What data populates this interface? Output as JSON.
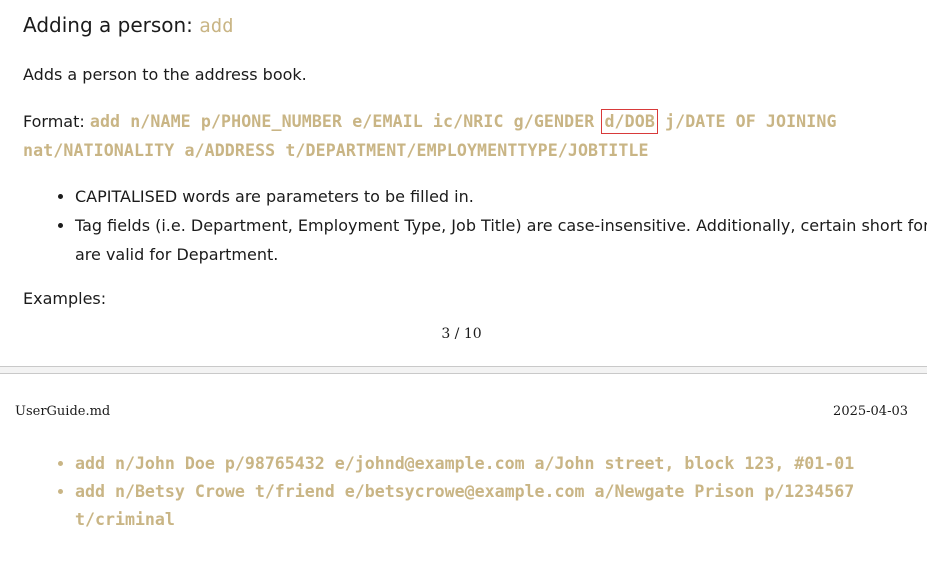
{
  "section": {
    "heading_prefix": "Adding a person: ",
    "heading_command": "add",
    "description": "Adds a person to the address book.",
    "format_label": "Format: ",
    "format_before": "add n/NAME p/PHONE_NUMBER e/EMAIL ic/NRIC g/GENDER ",
    "format_highlighted": "d/DOB",
    "format_after": " j/DATE OF JOINING nat/NATIONALITY a/ADDRESS t/DEPARTMENT/EMPLOYMENTTYPE/JOBTITLE",
    "notes": [
      "CAPITALISED words are parameters to be filled in.",
      "Tag fields (i.e. Department, Employment Type, Job Title) are case-insensitive. Additionally, certain short forms are valid for Department."
    ],
    "examples_label": "Examples:",
    "examples": [
      "add n/John Doe p/98765432 e/johnd@example.com a/John street, block 123, #01-01",
      "add n/Betsy Crowe t/friend e/betsycrowe@example.com a/Newgate Prison p/1234567 t/criminal"
    ]
  },
  "page": {
    "number": "3 / 10",
    "filename": "UserGuide.md",
    "date": "2025-04-03"
  },
  "colors": {
    "code_text": "#c9b585",
    "highlight_box": "#d83a3a"
  }
}
